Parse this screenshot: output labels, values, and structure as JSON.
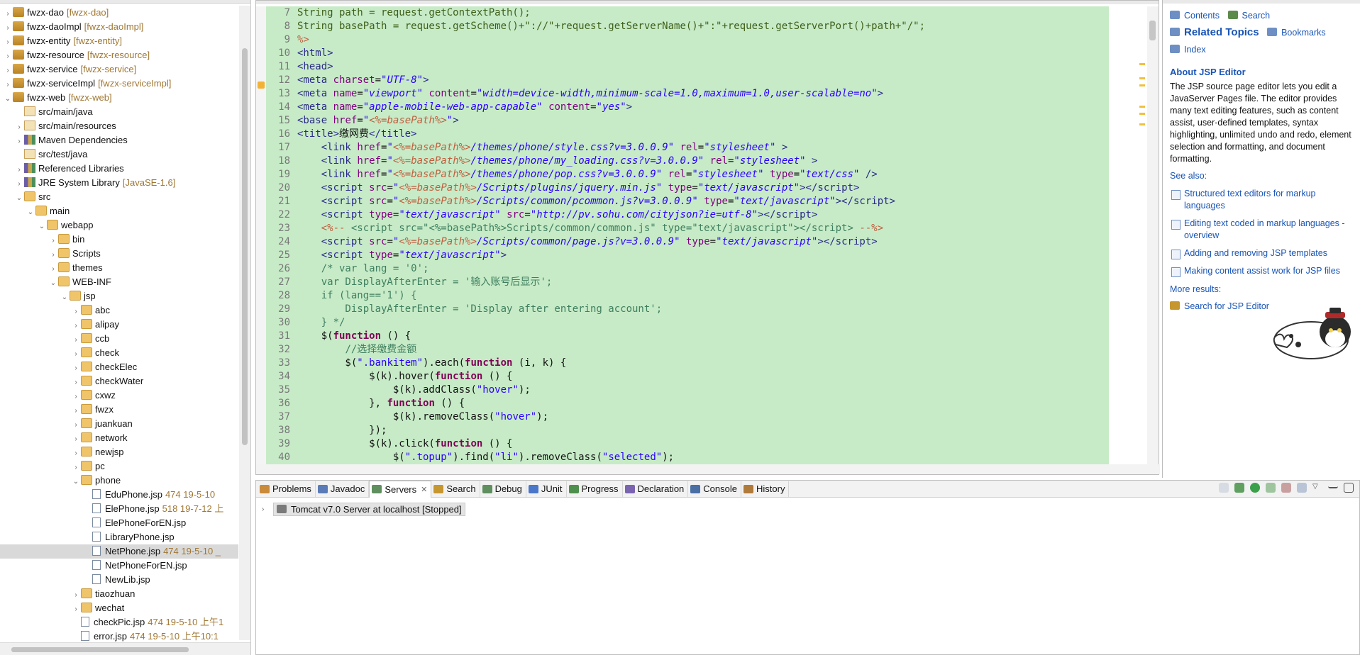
{
  "explorer": {
    "nodes": [
      {
        "indent": 0,
        "arrow": "›",
        "icon": "project",
        "label": "fwzx-dao",
        "dec": "[fwzx-dao]"
      },
      {
        "indent": 0,
        "arrow": "›",
        "icon": "project",
        "label": "fwzx-daoImpl",
        "dec": "[fwzx-daoImpl]"
      },
      {
        "indent": 0,
        "arrow": "›",
        "icon": "project",
        "label": "fwzx-entity",
        "dec": "[fwzx-entity]"
      },
      {
        "indent": 0,
        "arrow": "›",
        "icon": "project",
        "label": "fwzx-resource",
        "dec": "[fwzx-resource]"
      },
      {
        "indent": 0,
        "arrow": "›",
        "icon": "project",
        "label": "fwzx-service",
        "dec": "[fwzx-service]"
      },
      {
        "indent": 0,
        "arrow": "›",
        "icon": "project",
        "label": "fwzx-serviceImpl",
        "dec": "[fwzx-serviceImpl]"
      },
      {
        "indent": 0,
        "arrow": "⌄",
        "icon": "project",
        "label": "fwzx-web",
        "dec": "[fwzx-web]"
      },
      {
        "indent": 1,
        "arrow": "",
        "icon": "pkgroot",
        "label": "src/main/java",
        "dec": ""
      },
      {
        "indent": 1,
        "arrow": "›",
        "icon": "pkgroot",
        "label": "src/main/resources",
        "dec": ""
      },
      {
        "indent": 1,
        "arrow": "›",
        "icon": "lib",
        "label": "Maven Dependencies",
        "dec": ""
      },
      {
        "indent": 1,
        "arrow": "",
        "icon": "pkgroot",
        "label": "src/test/java",
        "dec": ""
      },
      {
        "indent": 1,
        "arrow": "›",
        "icon": "lib",
        "label": "Referenced Libraries",
        "dec": ""
      },
      {
        "indent": 1,
        "arrow": "›",
        "icon": "lib",
        "label": "JRE System Library",
        "dec": "[JavaSE-1.6]"
      },
      {
        "indent": 1,
        "arrow": "⌄",
        "icon": "folder",
        "label": "src",
        "dec": ""
      },
      {
        "indent": 2,
        "arrow": "⌄",
        "icon": "folder",
        "label": "main",
        "dec": ""
      },
      {
        "indent": 3,
        "arrow": "⌄",
        "icon": "folder",
        "label": "webapp",
        "dec": ""
      },
      {
        "indent": 4,
        "arrow": "›",
        "icon": "folder",
        "label": "bin",
        "dec": ""
      },
      {
        "indent": 4,
        "arrow": "›",
        "icon": "folder",
        "label": "Scripts",
        "dec": ""
      },
      {
        "indent": 4,
        "arrow": "›",
        "icon": "folder",
        "label": "themes",
        "dec": ""
      },
      {
        "indent": 4,
        "arrow": "⌄",
        "icon": "folder",
        "label": "WEB-INF",
        "dec": ""
      },
      {
        "indent": 5,
        "arrow": "⌄",
        "icon": "folder",
        "label": "jsp",
        "dec": ""
      },
      {
        "indent": 6,
        "arrow": "›",
        "icon": "folder",
        "label": "abc",
        "dec": ""
      },
      {
        "indent": 6,
        "arrow": "›",
        "icon": "folder",
        "label": "alipay",
        "dec": ""
      },
      {
        "indent": 6,
        "arrow": "›",
        "icon": "folder",
        "label": "ccb",
        "dec": ""
      },
      {
        "indent": 6,
        "arrow": "›",
        "icon": "folder",
        "label": "check",
        "dec": ""
      },
      {
        "indent": 6,
        "arrow": "›",
        "icon": "folder",
        "label": "checkElec",
        "dec": ""
      },
      {
        "indent": 6,
        "arrow": "›",
        "icon": "folder",
        "label": "checkWater",
        "dec": ""
      },
      {
        "indent": 6,
        "arrow": "›",
        "icon": "folder",
        "label": "cxwz",
        "dec": ""
      },
      {
        "indent": 6,
        "arrow": "›",
        "icon": "folder",
        "label": "fwzx",
        "dec": ""
      },
      {
        "indent": 6,
        "arrow": "›",
        "icon": "folder",
        "label": "juankuan",
        "dec": ""
      },
      {
        "indent": 6,
        "arrow": "›",
        "icon": "folder",
        "label": "network",
        "dec": ""
      },
      {
        "indent": 6,
        "arrow": "›",
        "icon": "folder",
        "label": "newjsp",
        "dec": ""
      },
      {
        "indent": 6,
        "arrow": "›",
        "icon": "folder",
        "label": "pc",
        "dec": ""
      },
      {
        "indent": 6,
        "arrow": "⌄",
        "icon": "folder",
        "label": "phone",
        "dec": ""
      },
      {
        "indent": 7,
        "arrow": "",
        "icon": "file",
        "label": "EduPhone.jsp",
        "dec": "474  19-5-10"
      },
      {
        "indent": 7,
        "arrow": "",
        "icon": "file",
        "label": "ElePhone.jsp",
        "dec": "518  19-7-12 上"
      },
      {
        "indent": 7,
        "arrow": "",
        "icon": "file",
        "label": "ElePhoneForEN.jsp",
        "dec": ""
      },
      {
        "indent": 7,
        "arrow": "",
        "icon": "file",
        "label": "LibraryPhone.jsp",
        "dec": ""
      },
      {
        "indent": 7,
        "arrow": "",
        "icon": "file",
        "label": "NetPhone.jsp",
        "dec": "474  19-5-10 _",
        "selected": true
      },
      {
        "indent": 7,
        "arrow": "",
        "icon": "file",
        "label": "NetPhoneForEN.jsp",
        "dec": ""
      },
      {
        "indent": 7,
        "arrow": "",
        "icon": "file",
        "label": "NewLib.jsp",
        "dec": ""
      },
      {
        "indent": 6,
        "arrow": "›",
        "icon": "folder",
        "label": "tiaozhuan",
        "dec": ""
      },
      {
        "indent": 6,
        "arrow": "›",
        "icon": "folder",
        "label": "wechat",
        "dec": ""
      },
      {
        "indent": 6,
        "arrow": "",
        "icon": "file",
        "label": "checkPic.jsp",
        "dec": "474  19-5-10 上午1"
      },
      {
        "indent": 6,
        "arrow": "",
        "icon": "file",
        "label": "error.jsp",
        "dec": "474  19-5-10 上午10:1"
      }
    ]
  },
  "editor": {
    "lines": [
      {
        "n": "7",
        "html": "<span class='java'>String path = request.getContextPath();</span>"
      },
      {
        "n": "8",
        "html": "<span class='java'>String basePath = request.getScheme()+\"://\"+request.getServerName()+\":\"+request.getServerPort()+path+\"/\";</span>"
      },
      {
        "n": "9",
        "html": "<span class='jsp'>%&gt;</span>"
      },
      {
        "n": "10",
        "html": "<span class='tag'>&lt;html&gt;</span>"
      },
      {
        "n": "11",
        "html": "<span class='tag'>&lt;head&gt;</span>"
      },
      {
        "n": "12",
        "html": "<span class='tag'>&lt;meta</span> <span class='attr'>charset</span>=<span class='val'>\"UTF-8\"</span><span class='tag'>&gt;</span>"
      },
      {
        "n": "13",
        "html": "<span class='tag'>&lt;meta</span> <span class='attr'>name</span>=<span class='val'>\"viewport\"</span> <span class='attr'>content</span>=<span class='val'>\"width=device-width,minimum-scale=1.0,maximum=1.0,user-scalable=no\"</span><span class='tag'>&gt;</span>"
      },
      {
        "n": "14",
        "html": "<span class='tag'>&lt;meta</span> <span class='attr'>name</span>=<span class='val'>\"apple-mobile-web-app-capable\"</span> <span class='attr'>content</span>=<span class='val'>\"yes\"</span><span class='tag'>&gt;</span>"
      },
      {
        "n": "15",
        "html": "<span class='tag'>&lt;base</span> <span class='attr'>href</span>=<span class='val'>\"<span class='jsp'>&lt;%=basePath%&gt;</span>\"</span><span class='tag'>&gt;</span>"
      },
      {
        "n": "16",
        "html": "<span class='tag'>&lt;title&gt;</span>缴网费<span class='tag'>&lt;/title&gt;</span>"
      },
      {
        "n": "17",
        "html": "    <span class='tag'>&lt;link</span> <span class='attr'>href</span>=<span class='val'>\"<span class='jsp'>&lt;%=basePath%&gt;</span>/themes/phone/style.css?v=3.0.0.9\"</span> <span class='attr'>rel</span>=<span class='val'>\"stylesheet\"</span> <span class='tag'>&gt;</span>"
      },
      {
        "n": "18",
        "html": "    <span class='tag'>&lt;link</span> <span class='attr'>href</span>=<span class='val'>\"<span class='jsp'>&lt;%=basePath%&gt;</span>/themes/phone/my_loading.css?v=3.0.0.9\"</span> <span class='attr'>rel</span>=<span class='val'>\"stylesheet\"</span> <span class='tag'>&gt;</span>"
      },
      {
        "n": "19",
        "html": "    <span class='tag'>&lt;link</span> <span class='attr'>href</span>=<span class='val'>\"<span class='jsp'>&lt;%=basePath%&gt;</span>/themes/phone/pop.css?v=3.0.0.9\"</span> <span class='attr'>rel</span>=<span class='val'>\"stylesheet\"</span> <span class='attr'>type</span>=<span class='val'>\"text/css\"</span> <span class='tag'>/&gt;</span>"
      },
      {
        "n": "20",
        "html": "    <span class='tag'>&lt;script</span> <span class='attr'>src</span>=<span class='val'>\"<span class='jsp'>&lt;%=basePath%&gt;</span>/Scripts/plugins/jquery.min.js\"</span> <span class='attr'>type</span>=<span class='val'>\"text/javascript\"</span><span class='tag'>&gt;&lt;/script&gt;</span>"
      },
      {
        "n": "21",
        "html": "    <span class='tag'>&lt;script</span> <span class='attr'>src</span>=<span class='val'>\"<span class='jsp'>&lt;%=basePath%&gt;</span>/Scripts/common/pcommon.js?v=3.0.0.9\"</span> <span class='attr'>type</span>=<span class='val'>\"text/javascript\"</span><span class='tag'>&gt;&lt;/script&gt;</span>"
      },
      {
        "n": "22",
        "html": "    <span class='tag'>&lt;script</span> <span class='attr'>type</span>=<span class='val'>\"text/javascript\"</span> <span class='attr'>src</span>=<span class='val'>\"http://pv.sohu.com/cityjson?ie=utf-8\"</span><span class='tag'>&gt;&lt;/script&gt;</span>"
      },
      {
        "n": "23",
        "html": "    <span class='jsp'>&lt;%-- </span><span class='cmt'>&lt;script src=\"&lt;%=basePath%&gt;Scripts/common/common.js\" type=\"text/javascript\"&gt;&lt;/script&gt; </span><span class='jsp'>--%&gt;</span>"
      },
      {
        "n": "24",
        "html": "    <span class='tag'>&lt;script</span> <span class='attr'>src</span>=<span class='val'>\"<span class='jsp'>&lt;%=basePath%&gt;</span>/Scripts/common/page.js?v=3.0.0.9\"</span> <span class='attr'>type</span>=<span class='val'>\"text/javascript\"</span><span class='tag'>&gt;&lt;/script&gt;</span>"
      },
      {
        "n": "25",
        "html": "    <span class='tag'>&lt;script</span> <span class='attr'>type</span>=<span class='val'>\"text/javascript\"</span><span class='tag'>&gt;</span>"
      },
      {
        "n": "26",
        "html": "    <span class='cmt'>/* var lang = '0';</span>"
      },
      {
        "n": "27",
        "html": "<span class='cmt'>    var DisplayAfterEnter = '输入账号后显示';</span>"
      },
      {
        "n": "28",
        "html": "<span class='cmt'>    if (lang=='1') {</span>"
      },
      {
        "n": "29",
        "html": "<span class='cmt'>        DisplayAfterEnter = 'Display after entering account';</span>"
      },
      {
        "n": "30",
        "html": "<span class='cmt'>    } */</span>"
      },
      {
        "n": "31",
        "html": "    $(<span class='kw'>function</span> () {"
      },
      {
        "n": "32",
        "html": "        <span class='cmt'>//选择缴费金额</span>"
      },
      {
        "n": "33",
        "html": "        $(<span class='str'>\".bankitem\"</span>).each(<span class='kw'>function</span> (i, k) {"
      },
      {
        "n": "34",
        "html": "            $(k).hover(<span class='kw'>function</span> () {"
      },
      {
        "n": "35",
        "html": "                $(k).addClass(<span class='str'>\"hover\"</span>);"
      },
      {
        "n": "36",
        "html": "            }, <span class='kw'>function</span> () {"
      },
      {
        "n": "37",
        "html": "                $(k).removeClass(<span class='str'>\"hover\"</span>);"
      },
      {
        "n": "38",
        "html": "            });"
      },
      {
        "n": "39",
        "html": "            $(k).click(<span class='kw'>function</span> () {"
      },
      {
        "n": "40",
        "html": "                $(<span class='str'>\".topup\"</span>).find(<span class='str'>\"li\"</span>).removeClass(<span class='str'>\"selected\"</span>);"
      }
    ]
  },
  "help": {
    "contents": "Contents",
    "search": "Search",
    "related_topics": "Related Topics",
    "bookmarks": "Bookmarks",
    "index": "Index",
    "about_title": "About JSP Editor",
    "about_text": "The JSP source page editor lets you edit a JavaServer Pages file. The editor provides many text editing features, such as content assist, user-defined templates, syntax highlighting, unlimited undo and redo, element selection and formatting, and document formatting.",
    "see_also": "See also:",
    "links": [
      "Structured text editors for markup languages",
      "Editing text coded in markup languages - overview",
      "Adding and removing JSP templates",
      "Making content assist work for JSP files"
    ],
    "more_results": "More results:",
    "search_jsp": "Search for JSP Editor"
  },
  "bottom": {
    "tabs": [
      {
        "label": "Problems",
        "icon": "problems-icon",
        "color": "#c98a3a"
      },
      {
        "label": "Javadoc",
        "icon": "at-icon",
        "color": "#5a7bb5"
      },
      {
        "label": "Servers",
        "icon": "servers-icon",
        "color": "#5f8f5f",
        "active": true
      },
      {
        "label": "Search",
        "icon": "search-icon",
        "color": "#c6962f"
      },
      {
        "label": "Debug",
        "icon": "debug-icon",
        "color": "#5f8f5f"
      },
      {
        "label": "JUnit",
        "icon": "junit-icon",
        "color": "#4a77c9"
      },
      {
        "label": "Progress",
        "icon": "progress-icon",
        "color": "#4e8f4e"
      },
      {
        "label": "Declaration",
        "icon": "declaration-icon",
        "color": "#7a64b0"
      },
      {
        "label": "Console",
        "icon": "console-icon",
        "color": "#4a6fa5"
      },
      {
        "label": "History",
        "icon": "history-icon",
        "color": "#b07a3a"
      }
    ],
    "server": "Tomcat v7.0 Server at localhost  [Stopped]"
  }
}
